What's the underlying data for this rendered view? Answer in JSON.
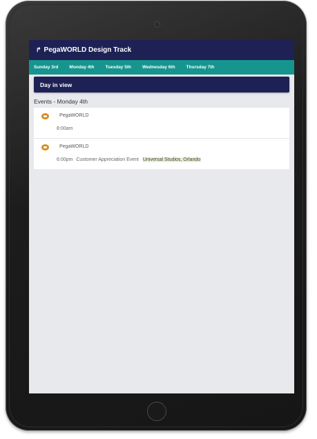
{
  "header": {
    "title": "PegaWORLD Design Track",
    "back_icon": "arrow-back-icon"
  },
  "tabs": [
    {
      "label": "Sunday 3rd"
    },
    {
      "label": "Monday 4th"
    },
    {
      "label": "Tuesday 5th"
    },
    {
      "label": "Wednesday 6th"
    },
    {
      "label": "Thursday 7th"
    }
  ],
  "view_button": {
    "label": "Day in view"
  },
  "events_heading": "Events - Monday 4th",
  "events": [
    {
      "title": "PegaWORLD",
      "time": "8:00am",
      "name": "",
      "location": ""
    },
    {
      "title": "PegaWORLD",
      "time": "6:00pm",
      "name": "Customer Appreciation Event",
      "location": "Universal Studios, Orlando"
    }
  ],
  "colors": {
    "header_bg": "#1e2154",
    "tabs_bg": "#16958f",
    "event_icon": "#d98a1a",
    "location_highlight": "#e9efd0"
  }
}
